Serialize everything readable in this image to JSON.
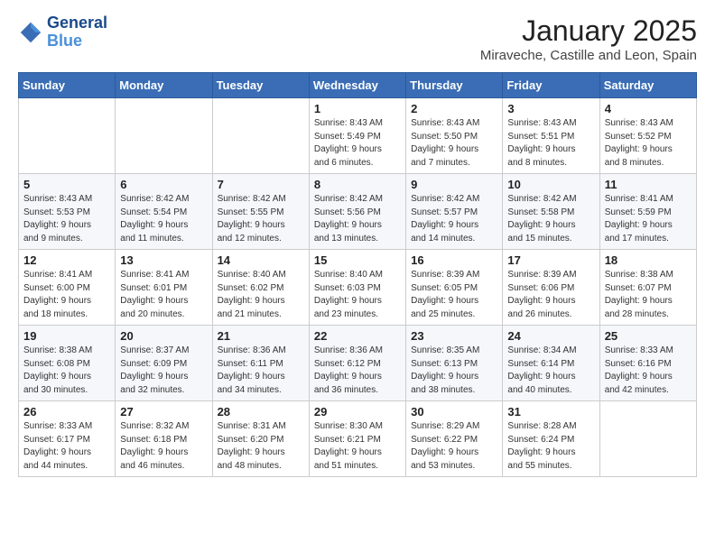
{
  "header": {
    "logo_line1": "General",
    "logo_line2": "Blue",
    "month_title": "January 2025",
    "subtitle": "Miraveche, Castille and Leon, Spain"
  },
  "weekdays": [
    "Sunday",
    "Monday",
    "Tuesday",
    "Wednesday",
    "Thursday",
    "Friday",
    "Saturday"
  ],
  "weeks": [
    [
      {
        "day": "",
        "info": ""
      },
      {
        "day": "",
        "info": ""
      },
      {
        "day": "",
        "info": ""
      },
      {
        "day": "1",
        "info": "Sunrise: 8:43 AM\nSunset: 5:49 PM\nDaylight: 9 hours\nand 6 minutes."
      },
      {
        "day": "2",
        "info": "Sunrise: 8:43 AM\nSunset: 5:50 PM\nDaylight: 9 hours\nand 7 minutes."
      },
      {
        "day": "3",
        "info": "Sunrise: 8:43 AM\nSunset: 5:51 PM\nDaylight: 9 hours\nand 8 minutes."
      },
      {
        "day": "4",
        "info": "Sunrise: 8:43 AM\nSunset: 5:52 PM\nDaylight: 9 hours\nand 8 minutes."
      }
    ],
    [
      {
        "day": "5",
        "info": "Sunrise: 8:43 AM\nSunset: 5:53 PM\nDaylight: 9 hours\nand 9 minutes."
      },
      {
        "day": "6",
        "info": "Sunrise: 8:42 AM\nSunset: 5:54 PM\nDaylight: 9 hours\nand 11 minutes."
      },
      {
        "day": "7",
        "info": "Sunrise: 8:42 AM\nSunset: 5:55 PM\nDaylight: 9 hours\nand 12 minutes."
      },
      {
        "day": "8",
        "info": "Sunrise: 8:42 AM\nSunset: 5:56 PM\nDaylight: 9 hours\nand 13 minutes."
      },
      {
        "day": "9",
        "info": "Sunrise: 8:42 AM\nSunset: 5:57 PM\nDaylight: 9 hours\nand 14 minutes."
      },
      {
        "day": "10",
        "info": "Sunrise: 8:42 AM\nSunset: 5:58 PM\nDaylight: 9 hours\nand 15 minutes."
      },
      {
        "day": "11",
        "info": "Sunrise: 8:41 AM\nSunset: 5:59 PM\nDaylight: 9 hours\nand 17 minutes."
      }
    ],
    [
      {
        "day": "12",
        "info": "Sunrise: 8:41 AM\nSunset: 6:00 PM\nDaylight: 9 hours\nand 18 minutes."
      },
      {
        "day": "13",
        "info": "Sunrise: 8:41 AM\nSunset: 6:01 PM\nDaylight: 9 hours\nand 20 minutes."
      },
      {
        "day": "14",
        "info": "Sunrise: 8:40 AM\nSunset: 6:02 PM\nDaylight: 9 hours\nand 21 minutes."
      },
      {
        "day": "15",
        "info": "Sunrise: 8:40 AM\nSunset: 6:03 PM\nDaylight: 9 hours\nand 23 minutes."
      },
      {
        "day": "16",
        "info": "Sunrise: 8:39 AM\nSunset: 6:05 PM\nDaylight: 9 hours\nand 25 minutes."
      },
      {
        "day": "17",
        "info": "Sunrise: 8:39 AM\nSunset: 6:06 PM\nDaylight: 9 hours\nand 26 minutes."
      },
      {
        "day": "18",
        "info": "Sunrise: 8:38 AM\nSunset: 6:07 PM\nDaylight: 9 hours\nand 28 minutes."
      }
    ],
    [
      {
        "day": "19",
        "info": "Sunrise: 8:38 AM\nSunset: 6:08 PM\nDaylight: 9 hours\nand 30 minutes."
      },
      {
        "day": "20",
        "info": "Sunrise: 8:37 AM\nSunset: 6:09 PM\nDaylight: 9 hours\nand 32 minutes."
      },
      {
        "day": "21",
        "info": "Sunrise: 8:36 AM\nSunset: 6:11 PM\nDaylight: 9 hours\nand 34 minutes."
      },
      {
        "day": "22",
        "info": "Sunrise: 8:36 AM\nSunset: 6:12 PM\nDaylight: 9 hours\nand 36 minutes."
      },
      {
        "day": "23",
        "info": "Sunrise: 8:35 AM\nSunset: 6:13 PM\nDaylight: 9 hours\nand 38 minutes."
      },
      {
        "day": "24",
        "info": "Sunrise: 8:34 AM\nSunset: 6:14 PM\nDaylight: 9 hours\nand 40 minutes."
      },
      {
        "day": "25",
        "info": "Sunrise: 8:33 AM\nSunset: 6:16 PM\nDaylight: 9 hours\nand 42 minutes."
      }
    ],
    [
      {
        "day": "26",
        "info": "Sunrise: 8:33 AM\nSunset: 6:17 PM\nDaylight: 9 hours\nand 44 minutes."
      },
      {
        "day": "27",
        "info": "Sunrise: 8:32 AM\nSunset: 6:18 PM\nDaylight: 9 hours\nand 46 minutes."
      },
      {
        "day": "28",
        "info": "Sunrise: 8:31 AM\nSunset: 6:20 PM\nDaylight: 9 hours\nand 48 minutes."
      },
      {
        "day": "29",
        "info": "Sunrise: 8:30 AM\nSunset: 6:21 PM\nDaylight: 9 hours\nand 51 minutes."
      },
      {
        "day": "30",
        "info": "Sunrise: 8:29 AM\nSunset: 6:22 PM\nDaylight: 9 hours\nand 53 minutes."
      },
      {
        "day": "31",
        "info": "Sunrise: 8:28 AM\nSunset: 6:24 PM\nDaylight: 9 hours\nand 55 minutes."
      },
      {
        "day": "",
        "info": ""
      }
    ]
  ]
}
